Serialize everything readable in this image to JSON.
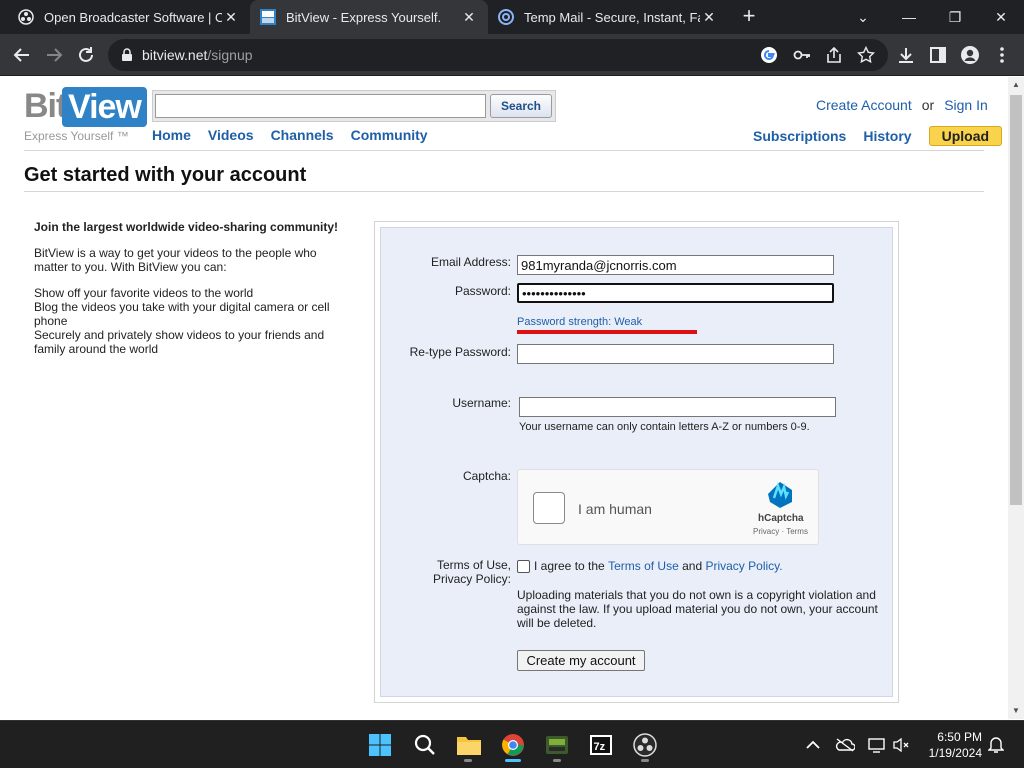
{
  "browser": {
    "tabs": [
      {
        "title": "Open Broadcaster Software | OBS",
        "favicon": "obs-icon"
      },
      {
        "title": "BitView - Express Yourself.",
        "favicon": "bitview-icon"
      },
      {
        "title": "Temp Mail - Secure, Instant, Fast",
        "favicon": "tempmail-icon"
      }
    ],
    "url_domain": "bitview.net",
    "url_path": "/signup"
  },
  "site": {
    "logo_bit": "Bit",
    "logo_view": "View",
    "tagline": "Express Yourself ™",
    "search_placeholder": "",
    "search_button": "Search",
    "nav": [
      "Home",
      "Videos",
      "Channels",
      "Community"
    ],
    "create_account": "Create Account",
    "or": "or",
    "sign_in": "Sign In",
    "subscriptions": "Subscriptions",
    "history": "History",
    "upload": "Upload"
  },
  "page": {
    "title": "Get started with your account",
    "intro_head": "Join the largest worldwide video-sharing community!",
    "intro_p1": "BitView is a way to get your videos to the people who matter to you. With BitView you can:",
    "intro_list": [
      "Show off your favorite videos to the world",
      "Blog the videos you take with your digital camera or cell phone",
      "Securely and privately show videos to your friends and family around the world"
    ]
  },
  "form": {
    "email_label": "Email Address:",
    "email_value": "981myranda@jcnorris.com",
    "password_label": "Password:",
    "password_value": "••••••••••••••",
    "password_strength": "Password strength: Weak",
    "retype_label": "Re-type Password:",
    "retype_value": "",
    "username_label": "Username:",
    "username_value": "",
    "username_hint": "Your username can only contain letters A-Z or numbers 0-9.",
    "captcha_label": "Captcha:",
    "captcha_text": "I am human",
    "captcha_brand": "hCaptcha",
    "captcha_links": "Privacy · Terms",
    "terms_label_1": "Terms of Use,",
    "terms_label_2": "Privacy Policy:",
    "agree_text": "I agree to the",
    "terms_link": "Terms of Use",
    "and_text": "and",
    "privacy_link": "Privacy Policy.",
    "warning": "Uploading materials that you do not own is a copyright violation and against the law. If you upload material you do not own, your account will be deleted.",
    "create_button": "Create my account"
  },
  "taskbar": {
    "time": "6:50 PM",
    "date": "1/19/2024"
  },
  "colors": {
    "link": "#1f5fa8",
    "logo_blue": "#2e82c5",
    "upload_yellow": "#f9d34b",
    "strength_weak": "#dd1111",
    "form_bg": "#e9eef8"
  }
}
